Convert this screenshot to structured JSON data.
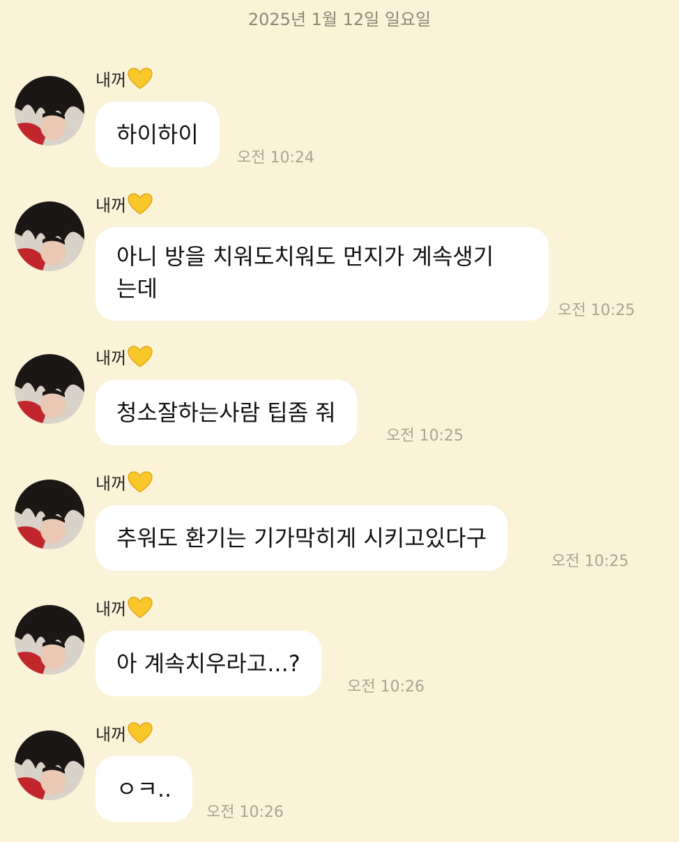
{
  "chat": {
    "date": "2025년 1월 12일 일요일",
    "colors": {
      "background": "#faf3d8",
      "bubble": "#ffffff",
      "time_text": "#a9a391",
      "date_text": "#8c8677",
      "heart": "#f9c72a"
    },
    "messages": [
      {
        "sender": "내꺼",
        "sender_icon": "yellow-heart-icon",
        "text": "하이하이",
        "time": "오전 10:24"
      },
      {
        "sender": "내꺼",
        "sender_icon": "yellow-heart-icon",
        "text": "아니 방을 치워도치워도 먼지가 계속생기\n는데",
        "time": "오전 10:25"
      },
      {
        "sender": "내꺼",
        "sender_icon": "yellow-heart-icon",
        "text": "청소잘하는사람 팁좀 줘",
        "time": "오전 10:25"
      },
      {
        "sender": "내꺼",
        "sender_icon": "yellow-heart-icon",
        "text": "추워도 환기는 기가막히게 시키고있다구",
        "time": "오전 10:25"
      },
      {
        "sender": "내꺼",
        "sender_icon": "yellow-heart-icon",
        "text": "아 계속치우라고...?",
        "time": "오전 10:26"
      },
      {
        "sender": "내꺼",
        "sender_icon": "yellow-heart-icon",
        "text": "ㅇㅋ..",
        "time": "오전 10:26"
      }
    ]
  }
}
